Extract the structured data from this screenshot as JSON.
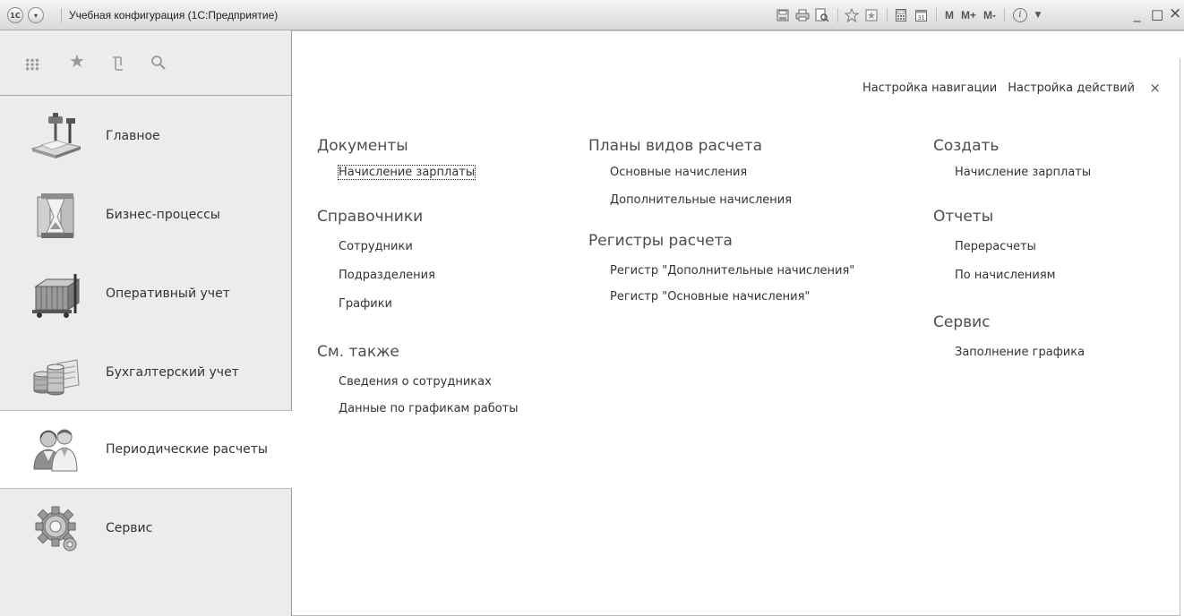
{
  "window": {
    "title": "Учебная конфигурация  (1С:Предприятие)",
    "logo_icon": "1c-logo-icon",
    "menu_icon": "dropdown-menu-icon",
    "tools": [
      {
        "name": "save-icon"
      },
      {
        "name": "print-icon"
      },
      {
        "name": "print-preview-icon"
      },
      {
        "name": "favorite-add-icon"
      },
      {
        "name": "favorites-icon"
      },
      {
        "name": "calculator-icon"
      },
      {
        "name": "calendar-icon"
      }
    ],
    "memory": [
      "M",
      "M+",
      "M-"
    ],
    "info_label": "i",
    "controls": {
      "minimize": "_",
      "maximize": "□",
      "close": "×"
    }
  },
  "sidebar": {
    "tools": [
      "apps-grid-icon",
      "star-icon",
      "history-icon",
      "search-icon"
    ],
    "sections": [
      {
        "label": "Главное",
        "icon": "desk-lamp-icon",
        "active": false
      },
      {
        "label": "Бизнес-процессы",
        "icon": "hourglass-icon",
        "active": false
      },
      {
        "label": "Оперативный учет",
        "icon": "warehouse-cart-icon",
        "active": false
      },
      {
        "label": "Бухгалтерский учет",
        "icon": "coins-icon",
        "active": false
      },
      {
        "label": "Периодические расчеты",
        "icon": "people-icon",
        "active": true
      },
      {
        "label": "Сервис",
        "icon": "gears-icon",
        "active": false
      }
    ]
  },
  "main": {
    "nav_settings": "Настройка навигации",
    "action_settings": "Настройка действий",
    "close": "×",
    "columns": [
      {
        "groups": [
          {
            "title": "Документы",
            "items": [
              "Начисление зарплаты"
            ]
          },
          {
            "title": "Справочники",
            "items": [
              "Сотрудники",
              "Подразделения",
              "Графики"
            ]
          },
          {
            "title": "См. также",
            "items": [
              "Сведения о сотрудниках",
              "Данные по графикам работы"
            ]
          }
        ]
      },
      {
        "groups": [
          {
            "title": "Планы видов расчета",
            "items": [
              "Основные начисления",
              "Дополнительные начисления"
            ]
          },
          {
            "title": "Регистры расчета",
            "items": [
              "Регистр \"Дополнительные начисления\"",
              "Регистр \"Основные начисления\""
            ]
          }
        ]
      },
      {
        "groups": [
          {
            "title": "Создать",
            "items": [
              "Начисление зарплаты"
            ]
          },
          {
            "title": "Отчеты",
            "items": [
              "Перерасчеты",
              "По начислениям"
            ]
          },
          {
            "title": "Сервис",
            "items": [
              "Заполнение графика"
            ]
          }
        ]
      }
    ]
  }
}
